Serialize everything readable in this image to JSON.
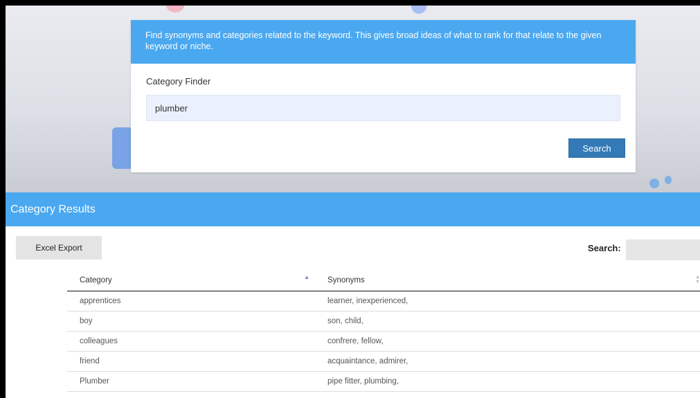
{
  "finder": {
    "description": "Find synonyms and categories related to the keyword. This gives broad ideas of what to rank for that relate to the given keyword or niche.",
    "label": "Category Finder",
    "keyword_value": "plumber",
    "search_button": "Search"
  },
  "results": {
    "title": "Category Results",
    "export_button": "Excel Export",
    "search_label": "Search:",
    "search_value": "",
    "columns": {
      "category": "Category",
      "synonyms": "Synonyms"
    },
    "rows": [
      {
        "category": "apprentices",
        "synonyms": "learner, inexperienced,"
      },
      {
        "category": "boy",
        "synonyms": "son, child,"
      },
      {
        "category": "colleagues",
        "synonyms": "confrere, fellow,"
      },
      {
        "category": "friend",
        "synonyms": "acquaintance, admirer,"
      },
      {
        "category": "Plumber",
        "synonyms": "pipe fitter, plumbing,"
      }
    ]
  },
  "icons": {
    "sort_ascending": "sort-ascending-icon",
    "sort_both": "sort-both-icon"
  },
  "colors": {
    "header_blue": "#4aa8f0",
    "button_blue": "#337ab7",
    "input_bg": "#eaf1fc"
  }
}
